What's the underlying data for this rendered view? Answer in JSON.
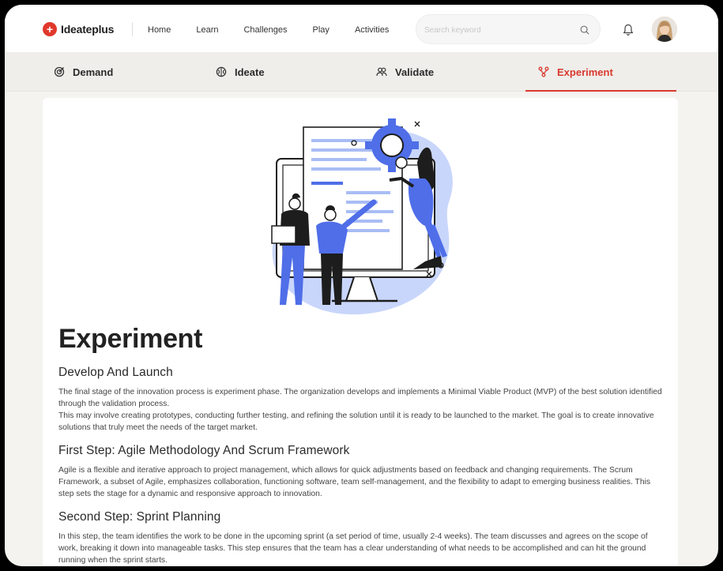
{
  "brand": {
    "name": "Ideateplus",
    "color": "#e0382b"
  },
  "nav": {
    "links": [
      "Home",
      "Learn",
      "Challenges",
      "Play",
      "Activities"
    ],
    "search_placeholder": "Search keyword",
    "search_icon": "search-icon",
    "bell_icon": "bell-icon"
  },
  "tabs": [
    {
      "label": "Demand",
      "icon": "target-icon"
    },
    {
      "label": "Ideate",
      "icon": "brain-icon"
    },
    {
      "label": "Validate",
      "icon": "users-icon"
    },
    {
      "label": "Experiment",
      "icon": "branch-icon",
      "active": true
    }
  ],
  "accent": "#d93a2f",
  "content": {
    "title": "Experiment",
    "sections": [
      {
        "heading": "Develop And Launch",
        "paragraphs": [
          "The final stage of the innovation process is experiment phase. The organization develops and implements a Minimal Viable Product (MVP) of the best solution identified through the validation process.",
          "This may involve creating prototypes, conducting further testing, and refining the solution until it is ready to be launched to the market. The goal is to create innovative solutions that truly meet the needs of the target market."
        ]
      },
      {
        "heading": "First Step: Agile Methodology And Scrum Framework",
        "paragraphs": [
          "Agile is a flexible and iterative approach to project management, which allows for quick adjustments based on feedback and changing requirements. The Scrum Framework, a subset of Agile, emphasizes collaboration, functioning software, team self-management, and the flexibility to adapt to emerging business realities. This step sets the stage for a dynamic and responsive approach to innovation."
        ]
      },
      {
        "heading": "Second Step: Sprint Planning",
        "paragraphs": [
          "In this step, the team identifies the work to be done in the upcoming sprint (a set period of time, usually 2-4 weeks). The team discusses and agrees on the scope of work, breaking it down into manageable tasks. This step ensures that the team has a clear understanding of what needs to be accomplished and can hit the ground running when the sprint starts."
        ]
      }
    ]
  }
}
